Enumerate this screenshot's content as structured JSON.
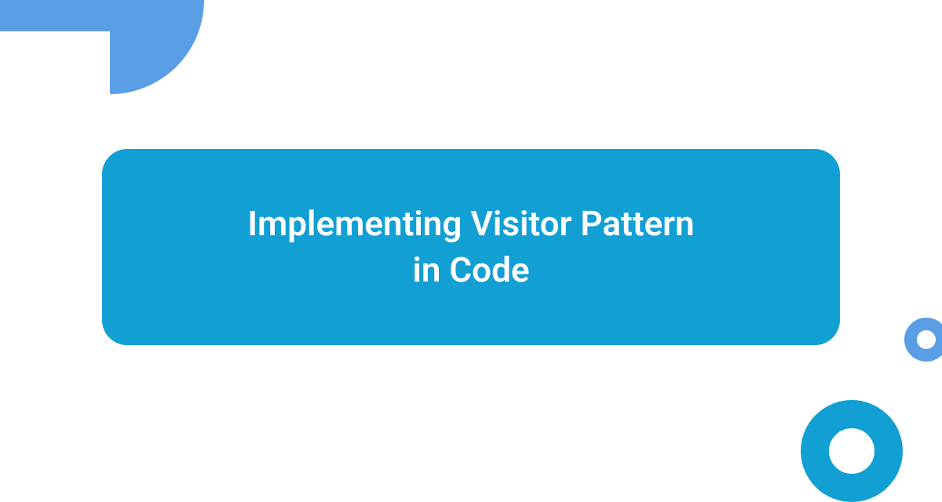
{
  "title": {
    "line1": "Implementing Visitor Pattern",
    "line2": "in Code"
  },
  "colors": {
    "primary": "#119fd4",
    "secondary": "#5a9ee6",
    "background": "#ffffff"
  }
}
